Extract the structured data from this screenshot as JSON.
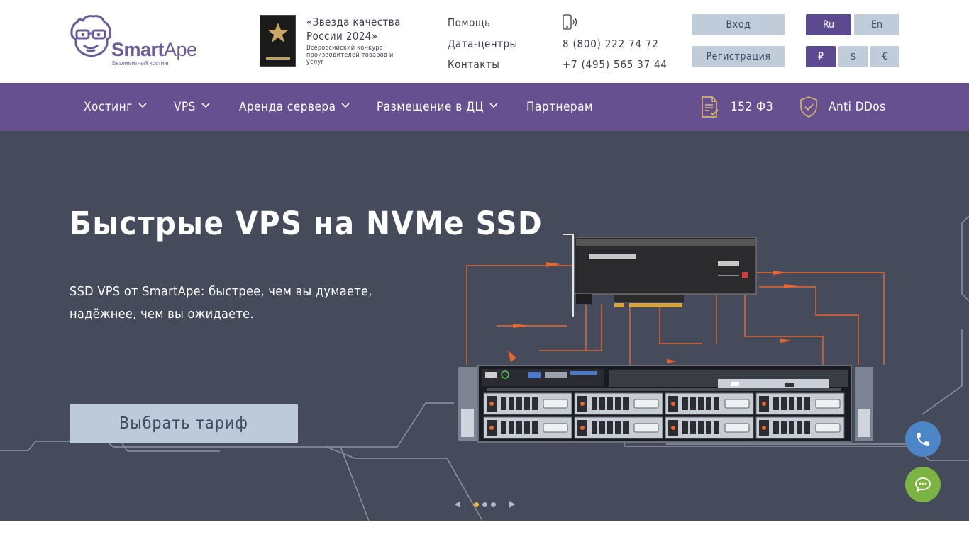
{
  "header": {
    "logo": {
      "name_a": "Smart",
      "name_b": "Ape",
      "tagline": "Безлимитный хостинг"
    },
    "award": {
      "title": "«Звезда качества России 2024»",
      "subtitle": "Всероссийский конкурс производителей товаров и услуг"
    },
    "links": [
      "Помощь",
      "Дата-центры",
      "Контакты"
    ],
    "phones": [
      "8 (800) 222 74 72",
      "+7 (495) 565 37 44"
    ],
    "login_label": "Вход",
    "register_label": "Регистрация",
    "languages": [
      {
        "label": "Ru",
        "active": true
      },
      {
        "label": "En",
        "active": false
      }
    ],
    "currencies": [
      {
        "label": "₽",
        "active": true
      },
      {
        "label": "$",
        "active": false
      },
      {
        "label": "€",
        "active": false
      }
    ]
  },
  "nav": {
    "items": [
      "Хостинг",
      "VPS",
      "Аренда сервера",
      "Размещение в ДЦ",
      "Партнерам"
    ],
    "law_label": "152 ФЗ",
    "ddos_label": "Anti DDos"
  },
  "hero": {
    "title": "Быстрые VPS на NVMe SSD",
    "subtitle": "SSD VPS от SmartApe: быстрее, чем вы думаете, надёжнее, чем вы ожидаете.",
    "cta_label": "Выбрать тариф",
    "slides_total": 3,
    "slide_active": 1
  },
  "colors": {
    "brand": "#66508f",
    "hero_bg": "#454b5b",
    "button_grey": "#c0ccd9",
    "accent_orange": "#e8672e",
    "call_button": "#4d86c6",
    "chat_button": "#7cb342"
  },
  "icons": [
    "monkey-logo-icon",
    "award-star-icon",
    "phone-ring-icon",
    "chevron-down-icon",
    "document-check-icon",
    "shield-check-icon",
    "phone-icon",
    "chat-bubble-icon",
    "arrow-left-icon",
    "arrow-right-icon"
  ]
}
